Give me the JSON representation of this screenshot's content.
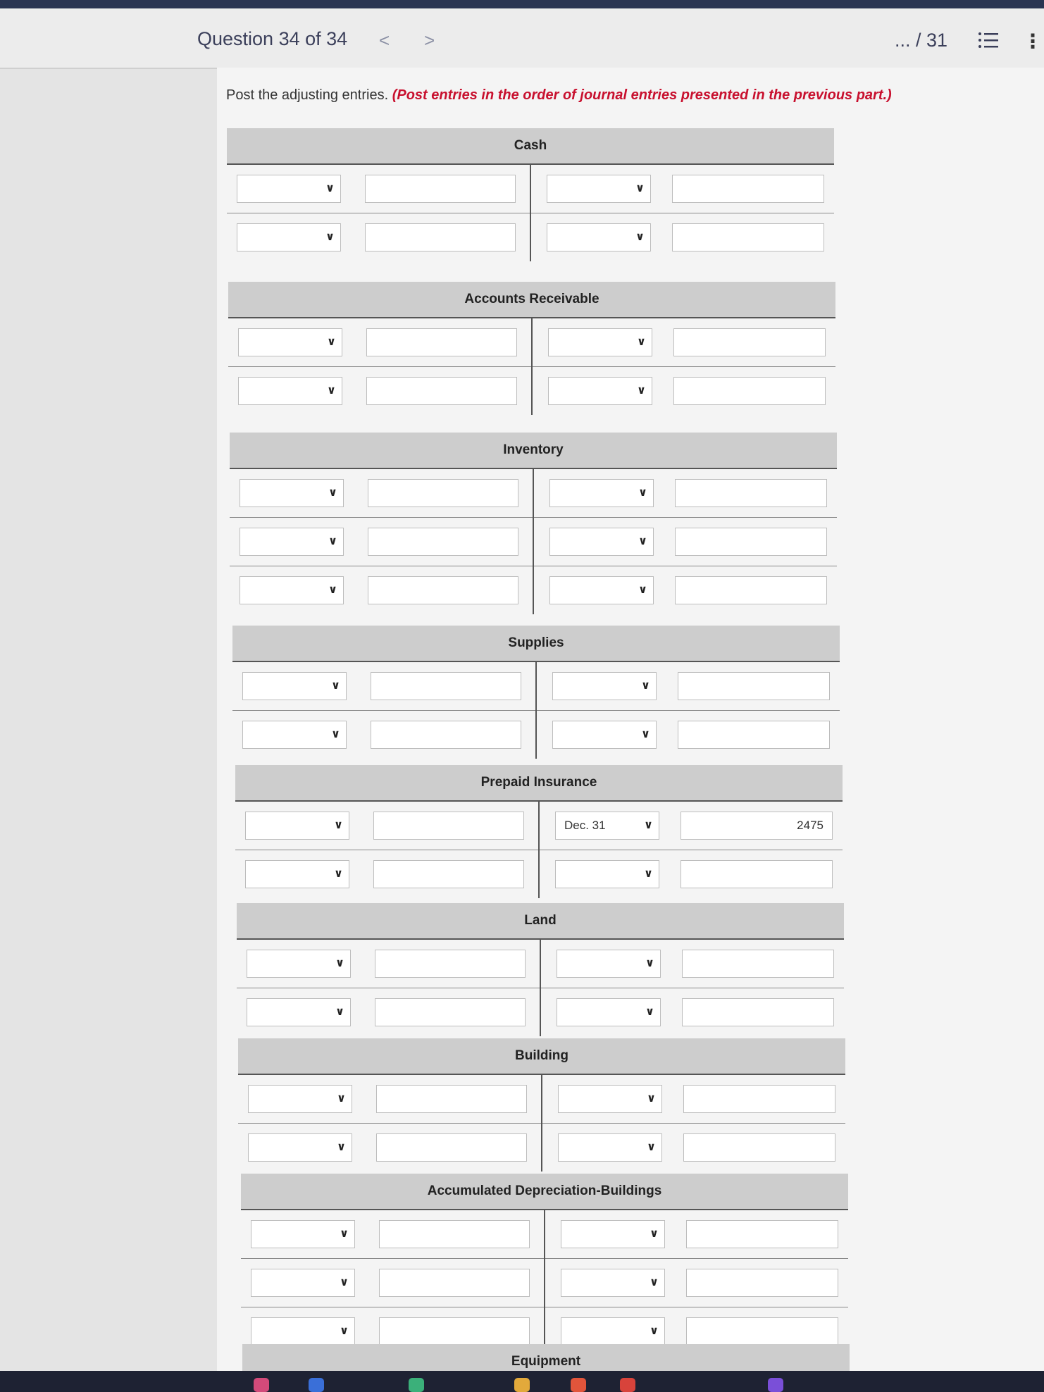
{
  "header": {
    "question_label": "Question 34 of 34",
    "prev": "<",
    "next": ">",
    "score": "... / 31",
    "more": "⋮"
  },
  "instructions": {
    "text": "Post the adjusting entries.",
    "emphasis": "(Post entries in the order of journal entries presented in the previous part.)"
  },
  "accounts": [
    {
      "name": "Cash",
      "rows": [
        {
          "ld": "",
          "la": "",
          "rd": "",
          "ra": ""
        },
        {
          "ld": "",
          "la": "",
          "rd": "",
          "ra": ""
        }
      ]
    },
    {
      "name": "Accounts Receivable",
      "rows": [
        {
          "ld": "",
          "la": "",
          "rd": "",
          "ra": ""
        },
        {
          "ld": "",
          "la": "",
          "rd": "",
          "ra": ""
        }
      ]
    },
    {
      "name": "Inventory",
      "rows": [
        {
          "ld": "",
          "la": "",
          "rd": "",
          "ra": ""
        },
        {
          "ld": "",
          "la": "",
          "rd": "",
          "ra": ""
        },
        {
          "ld": "",
          "la": "",
          "rd": "",
          "ra": ""
        }
      ]
    },
    {
      "name": "Supplies",
      "rows": [
        {
          "ld": "",
          "la": "",
          "rd": "",
          "ra": ""
        },
        {
          "ld": "",
          "la": "",
          "rd": "",
          "ra": ""
        }
      ]
    },
    {
      "name": "Prepaid Insurance",
      "rows": [
        {
          "ld": "",
          "la": "",
          "rd": "Dec. 31",
          "ra": "2475"
        },
        {
          "ld": "",
          "la": "",
          "rd": "",
          "ra": ""
        }
      ]
    },
    {
      "name": "Land",
      "rows": [
        {
          "ld": "",
          "la": "",
          "rd": "",
          "ra": ""
        },
        {
          "ld": "",
          "la": "",
          "rd": "",
          "ra": ""
        }
      ]
    },
    {
      "name": "Building",
      "rows": [
        {
          "ld": "",
          "la": "",
          "rd": "",
          "ra": ""
        },
        {
          "ld": "",
          "la": "",
          "rd": "",
          "ra": ""
        }
      ]
    },
    {
      "name": "Accumulated Depreciation-Buildings",
      "rows": [
        {
          "ld": "",
          "la": "",
          "rd": "",
          "ra": ""
        },
        {
          "ld": "",
          "la": "",
          "rd": "",
          "ra": ""
        },
        {
          "ld": "",
          "la": "",
          "rd": "",
          "ra": ""
        }
      ]
    },
    {
      "name": "Equipment",
      "rows": []
    }
  ]
}
